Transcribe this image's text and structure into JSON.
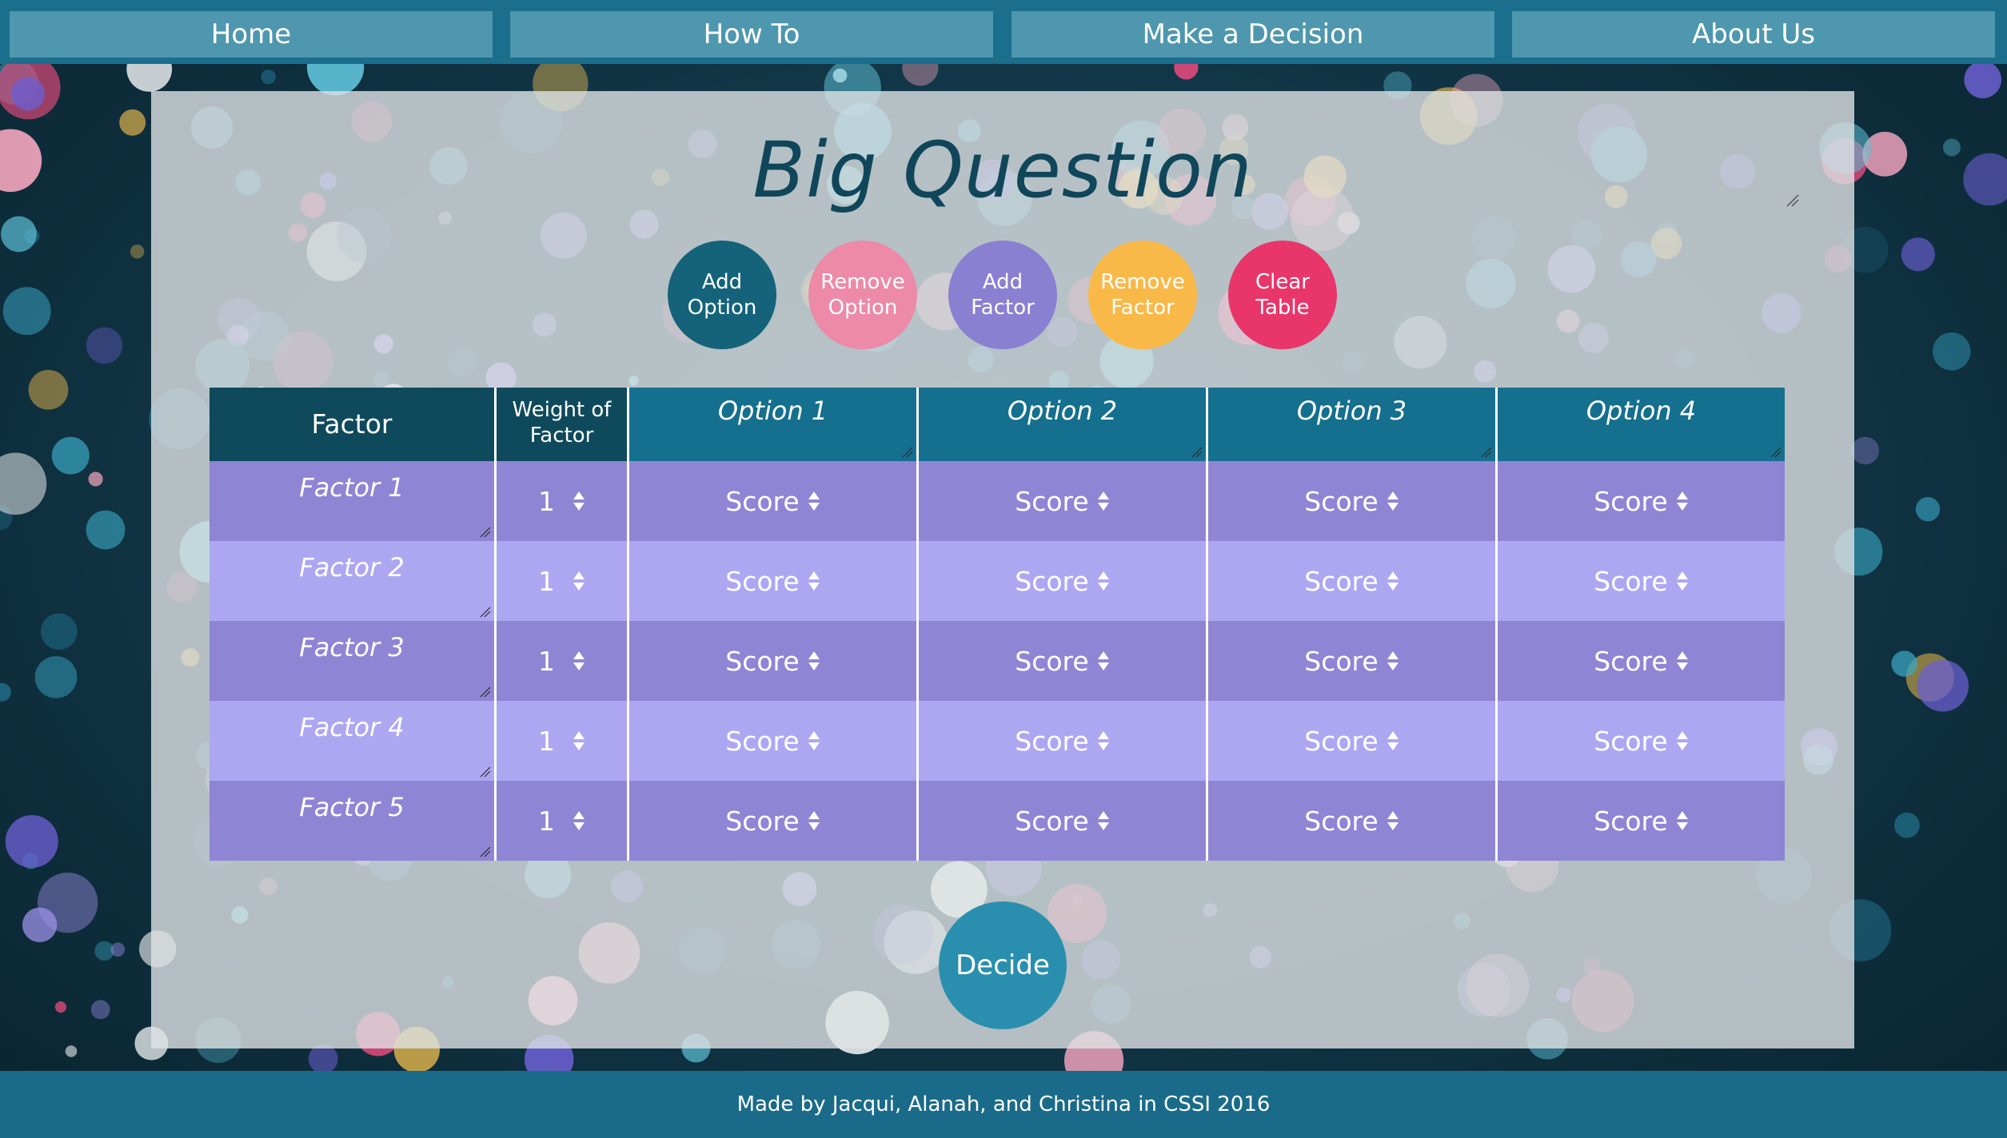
{
  "nav": {
    "items": [
      {
        "label": "Home"
      },
      {
        "label": "How To"
      },
      {
        "label": "Make a Decision"
      },
      {
        "label": "About Us"
      }
    ]
  },
  "main": {
    "title": "Big Question",
    "actions": [
      {
        "label": "Add Option",
        "color": "#14637a"
      },
      {
        "label": "Remove Option",
        "color": "#ec8aa8"
      },
      {
        "label": "Add Factor",
        "color": "#8a80d2"
      },
      {
        "label": "Remove Factor",
        "color": "#f9b948"
      },
      {
        "label": "Clear Table",
        "color": "#e8366a"
      }
    ],
    "table": {
      "factor_header": "Factor",
      "weight_header": "Weight of Factor",
      "options": [
        "Option 1",
        "Option 2",
        "Option 3",
        "Option 4"
      ],
      "rows": [
        {
          "factor": "Factor 1",
          "weight": "1",
          "scores": [
            "Score",
            "Score",
            "Score",
            "Score"
          ]
        },
        {
          "factor": "Factor 2",
          "weight": "1",
          "scores": [
            "Score",
            "Score",
            "Score",
            "Score"
          ]
        },
        {
          "factor": "Factor 3",
          "weight": "1",
          "scores": [
            "Score",
            "Score",
            "Score",
            "Score"
          ]
        },
        {
          "factor": "Factor 4",
          "weight": "1",
          "scores": [
            "Score",
            "Score",
            "Score",
            "Score"
          ]
        },
        {
          "factor": "Factor 5",
          "weight": "1",
          "scores": [
            "Score",
            "Score",
            "Score",
            "Score"
          ]
        }
      ]
    },
    "decide_label": "Decide"
  },
  "footer": {
    "text": "Made by Jacqui, Alanah, and Christina in CSSI 2016"
  },
  "colors": {
    "nav_bar": "#1b6e8c",
    "nav_item": "#4e97af",
    "header_factor": "#0f4a5c",
    "header_option": "#156f8e",
    "row_dark": "#8e85d4",
    "row_light": "#ada7f2",
    "decide": "#2a8fae",
    "title": "#10465a"
  }
}
